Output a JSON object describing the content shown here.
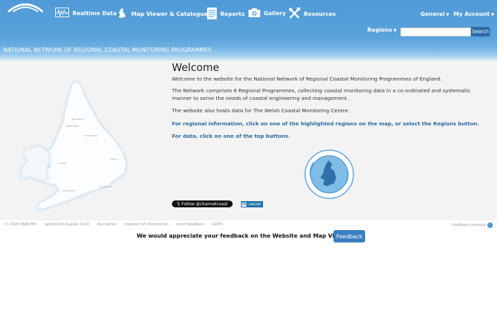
{
  "header": {
    "site_title": "NATIONAL NETWORK OF REGIONAL COASTAL MONITORING PROGRAMMES",
    "nav": [
      {
        "label": "Realtime Data",
        "icon": "waveform-icon"
      },
      {
        "label": "Map Viewer & Catalogue",
        "icon": "map-icon"
      },
      {
        "label": "Reports",
        "icon": "document-icon"
      },
      {
        "label": "Gallery",
        "icon": "camera-icon"
      },
      {
        "label": "Resources",
        "icon": "tools-icon"
      }
    ],
    "general": "General",
    "my_account": "My Account",
    "regions": "Regions",
    "search": {
      "placeholder": "",
      "button": "Search"
    }
  },
  "main": {
    "heading": "Welcome",
    "paragraphs": [
      "Welcome to the website for the National Network of Regional Coastal Monitoring Programmes of England.",
      "The Network comprises 6 Regional Programmes, collecting coastal monitoring data in a co-ordinated and systematic manner to serve the needs of coastal engineering and management.",
      "The website also hosts data for The Welsh Coastal Monitoring Centre."
    ],
    "links": [
      "For regional information, click on one of the highlighted regions on the map, or select the Regions button.",
      "For data, click on one of the top buttons."
    ],
    "follow": "Follow @channelcoast",
    "linkedin": "LINKEDIN"
  },
  "map": {
    "regions": [
      "NORTHEAST",
      "NORTHWEST",
      "EAST RIDING",
      "WALES",
      "ANGLIA",
      "SOUTHWEST",
      "SOUTHEAST"
    ]
  },
  "footer": {
    "items": [
      "© 2026 NNRCMP",
      "updated 8 August 2024",
      "disclaimer",
      "freedom of information",
      "send feedback",
      "GDPR"
    ],
    "geodata": "GeoData Institute"
  },
  "feedback": {
    "text": "We would appreciate your feedback on the Website and Map Viewer",
    "button": "Feedback"
  },
  "colors": {
    "header": "#5aa3dc",
    "link": "#2a6aa1",
    "button": "#3a7fc1"
  }
}
